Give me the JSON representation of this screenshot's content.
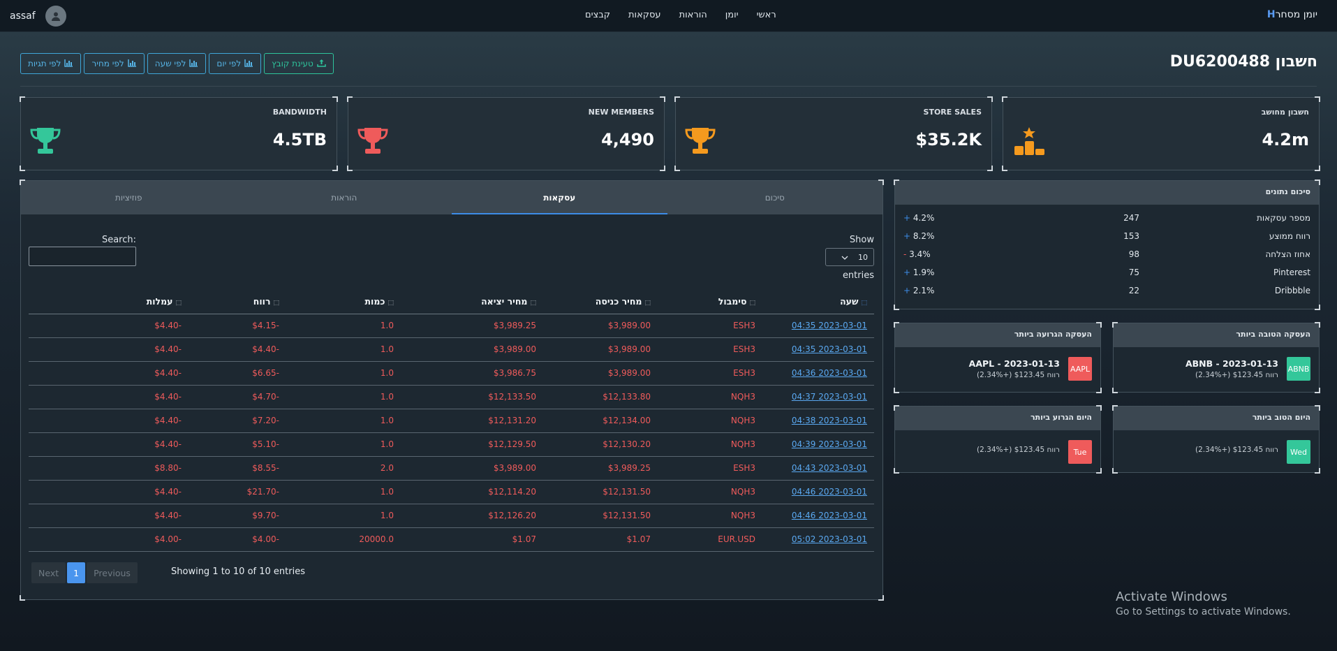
{
  "nav": {
    "brand_letter": "H",
    "brand_name": "יומן מסחר",
    "menu": [
      "ראשי",
      "יומן",
      "הוראות",
      "עסקאות",
      "קבצים"
    ],
    "username": "assaf"
  },
  "page": {
    "title": "חשבון DU6200488"
  },
  "toolbar": {
    "upload": "טעינת קובץ",
    "by_day": "לפי יום",
    "by_hour": "לפי שעה",
    "by_price": "לפי מחיר",
    "by_tags": "לפי תגיות"
  },
  "kpis": [
    {
      "label": "חשבון מחושב",
      "value": "4.2m",
      "icon": "podium-star-icon",
      "color": "#f59a1e"
    },
    {
      "label": "STORE SALES",
      "value": "$35.2K",
      "icon": "trophy-icon",
      "color": "#f59a1e"
    },
    {
      "label": "NEW MEMBERS",
      "value": "4,490",
      "icon": "trophy-icon",
      "color": "#ef5b5b"
    },
    {
      "label": "BANDWIDTH",
      "value": "4.5TB",
      "icon": "trophy-icon",
      "color": "#34c79a"
    }
  ],
  "tabs": [
    "סיכום",
    "עסקאות",
    "הוראות",
    "פוזיציות"
  ],
  "table_controls": {
    "show": "Show",
    "entries_value": "10",
    "entries": "entries",
    "search": "Search:",
    "next": "Next",
    "page": "1",
    "previous": "Previous",
    "info": "Showing 1 to 10 of 10 entries"
  },
  "columns": [
    "שעה",
    "סימבול",
    "מחיר כניסה",
    "מחיר יציאה",
    "כמות",
    "רווח",
    "עמלות"
  ],
  "rows": [
    {
      "time": "2023-03-01 04:35",
      "symbol": "ESH3",
      "entry": "$3,989.00",
      "exit": "$3,989.25",
      "qty": "1.0",
      "profit": "-$4.15",
      "fees": "-$4.40"
    },
    {
      "time": "2023-03-01 04:35",
      "symbol": "ESH3",
      "entry": "$3,989.00",
      "exit": "$3,989.00",
      "qty": "1.0",
      "profit": "-$4.40",
      "fees": "-$4.40"
    },
    {
      "time": "2023-03-01 04:36",
      "symbol": "ESH3",
      "entry": "$3,989.00",
      "exit": "$3,986.75",
      "qty": "1.0",
      "profit": "-$6.65",
      "fees": "-$4.40"
    },
    {
      "time": "2023-03-01 04:37",
      "symbol": "NQH3",
      "entry": "$12,133.80",
      "exit": "$12,133.50",
      "qty": "1.0",
      "profit": "-$4.70",
      "fees": "-$4.40"
    },
    {
      "time": "2023-03-01 04:38",
      "symbol": "NQH3",
      "entry": "$12,134.00",
      "exit": "$12,131.20",
      "qty": "1.0",
      "profit": "-$7.20",
      "fees": "-$4.40"
    },
    {
      "time": "2023-03-01 04:39",
      "symbol": "NQH3",
      "entry": "$12,130.20",
      "exit": "$12,129.50",
      "qty": "1.0",
      "profit": "-$5.10",
      "fees": "-$4.40"
    },
    {
      "time": "2023-03-01 04:43",
      "symbol": "ESH3",
      "entry": "$3,989.25",
      "exit": "$3,989.00",
      "qty": "2.0",
      "profit": "-$8.55",
      "fees": "-$8.80"
    },
    {
      "time": "2023-03-01 04:46",
      "symbol": "NQH3",
      "entry": "$12,131.50",
      "exit": "$12,114.20",
      "qty": "1.0",
      "profit": "-$21.70",
      "fees": "-$4.40"
    },
    {
      "time": "2023-03-01 04:46",
      "symbol": "NQH3",
      "entry": "$12,131.50",
      "exit": "$12,126.20",
      "qty": "1.0",
      "profit": "-$9.70",
      "fees": "-$4.40"
    },
    {
      "time": "2023-03-01 05:02",
      "symbol": "EUR.USD",
      "entry": "$1.07",
      "exit": "$1.07",
      "qty": "20000.0",
      "profit": "-$4.00",
      "fees": "-$4.00"
    }
  ],
  "summary": {
    "title": "סיכום נתונים",
    "rows": [
      {
        "name": "מספר עסקאות",
        "value": "247",
        "sign": "+",
        "pct": "4.2%"
      },
      {
        "name": "רווח ממוצע",
        "value": "153",
        "sign": "+",
        "pct": "8.2%"
      },
      {
        "name": "אחוז הצלחה",
        "value": "98",
        "sign": "-",
        "pct": "3.4%"
      },
      {
        "name": "Pinterest",
        "value": "75",
        "sign": "+",
        "pct": "1.9%"
      },
      {
        "name": "Dribbble",
        "value": "22",
        "sign": "+",
        "pct": "2.1%"
      }
    ]
  },
  "best_trade": {
    "title": "העסקה הטובה ביותר",
    "badge": "ABNB",
    "line1": "ABNB - 2023-01-13",
    "line2": "רווח $123.45 (+2.34%)"
  },
  "worst_trade": {
    "title": "העסקה הגרועה ביותר",
    "badge": "AAPL",
    "line1": "AAPL - 2023-01-13",
    "line2": "רווח $123.45 (+2.34%)"
  },
  "best_day": {
    "title": "היום הטוב ביותר",
    "badge": "Wed",
    "line2": "רווח $123.45 (+2.34%)"
  },
  "worst_day": {
    "title": "היום הגרוע ביותר",
    "badge": "Tue",
    "line2": "רווח $123.45 (+2.34%)"
  },
  "watermark": {
    "line1": "Activate Windows",
    "line2": "Go to Settings to activate Windows."
  }
}
